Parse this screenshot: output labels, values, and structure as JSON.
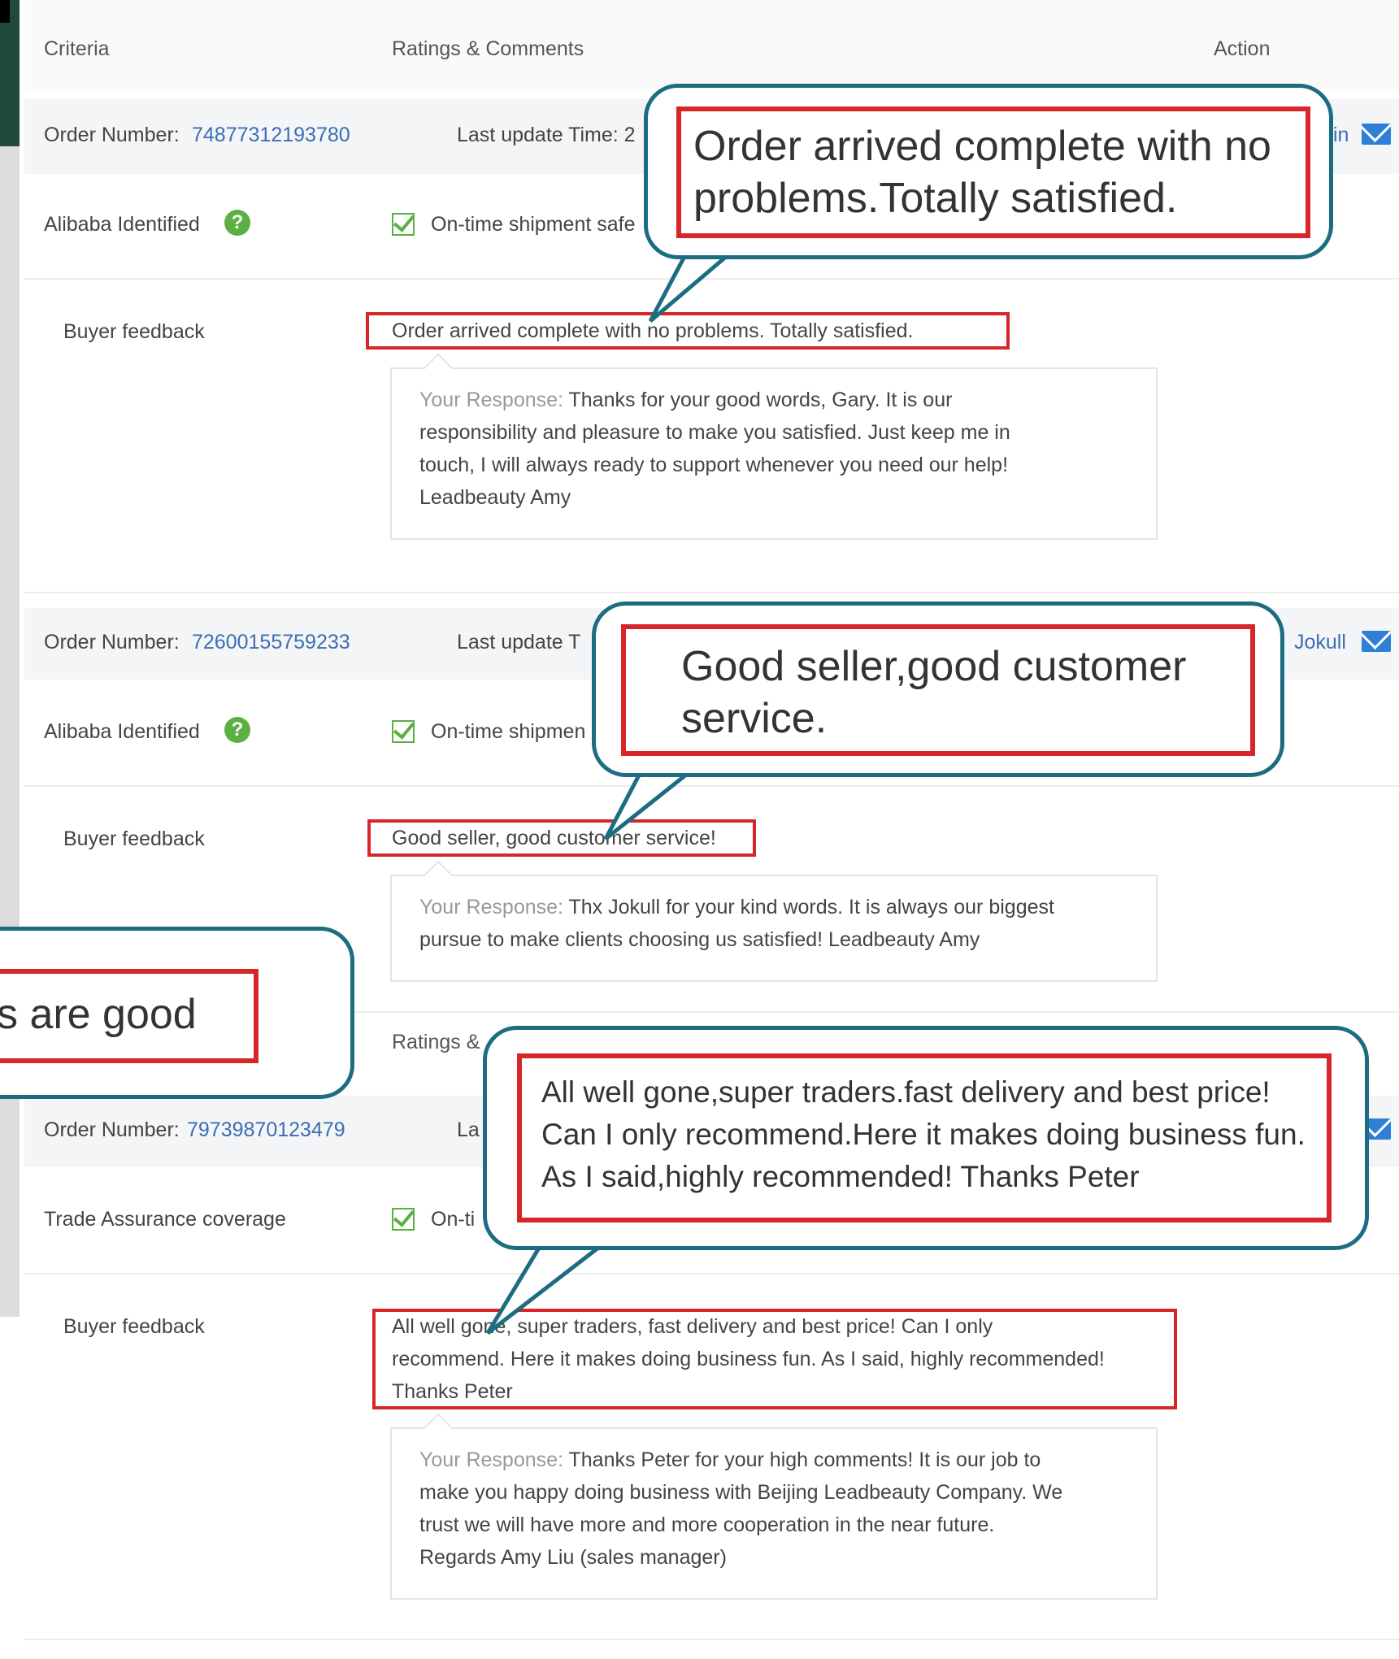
{
  "header": {
    "criteria": "Criteria",
    "ratings": "Ratings & Comments",
    "action": "Action"
  },
  "orders": [
    {
      "order_label": "Order Number:",
      "order_number": "74877312193780",
      "update_label": "Last update Time: 2",
      "action_name": "in",
      "identity": "Alibaba Identified",
      "shipment": "On-time shipment safe",
      "feedback_label": "Buyer feedback",
      "feedback": "Order arrived complete with no problems. Totally satisfied.",
      "response_label": "Your Response:",
      "response_lines": [
        "Thanks for your good words, Gary. It is our",
        "responsibility and pleasure to make you satisfied. Just keep me in",
        "touch, I will always ready to support whenever you need our help!",
        "Leadbeauty Amy"
      ]
    },
    {
      "order_label": "Order Number:",
      "order_number": "72600155759233",
      "update_label": "Last update T",
      "action_name": "Jokull",
      "identity": "Alibaba Identified",
      "shipment": "On-time shipmen",
      "feedback_label": "Buyer feedback",
      "feedback": "Good seller, good customer service!",
      "response_label": "Your Response:",
      "response_lines": [
        "Thx Jokull for your kind words. It is always our biggest",
        "pursue to make clients choosing us satisfied! Leadbeauty Amy"
      ]
    },
    {
      "ratings_partial": "Ratings &",
      "order_label": "Order Number:",
      "order_number": "79739870123479",
      "update_label": "La",
      "identity": "Trade Assurance coverage",
      "shipment": "On-ti",
      "feedback_label": "Buyer feedback",
      "feedback_lines": [
        "All well gone, super traders, fast delivery and best price! Can I only",
        "recommend. Here it makes doing business fun. As I said, highly recommended!",
        "Thanks Peter"
      ],
      "response_label": "Your Response:",
      "response_lines": [
        "Thanks Peter for your high comments! It is our job to",
        "make you happy doing business with Beijing Leadbeauty Company. We",
        "trust we will have more and more cooperation in the near future.",
        "Regards Amy Liu (sales manager)"
      ]
    }
  ],
  "callouts": {
    "first": [
      "Order arrived complete with no",
      "problems.Totally satisfied."
    ],
    "second": [
      "Good seller,good customer",
      "service."
    ],
    "left_partial": "s are good",
    "third": [
      "All well gone,super traders.fast delivery and best price!",
      "Can I only recommend.Here it makes doing business fun.",
      "As I said,highly recommended! Thanks Peter"
    ]
  },
  "colors": {
    "accent_blue": "#3b6eb4",
    "bubble_border": "#1d6d82",
    "highlight_red": "#d7262a",
    "check_green": "#5ab043"
  }
}
